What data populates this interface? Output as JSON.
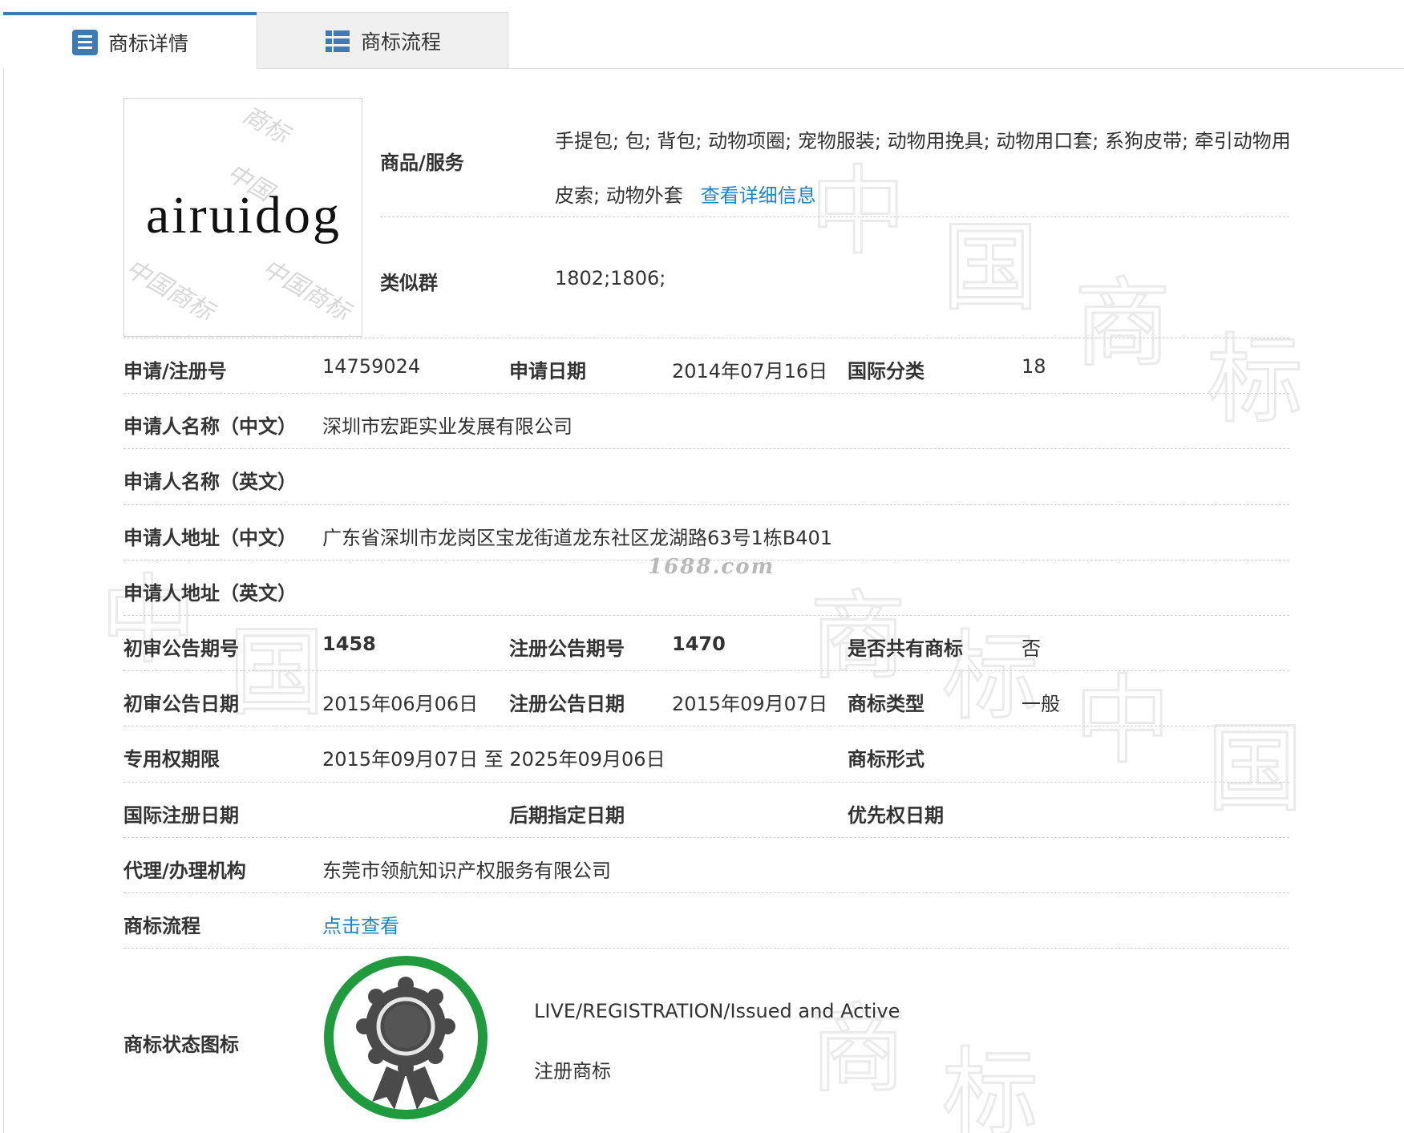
{
  "tabs": [
    {
      "label": "商标详情",
      "icon": "document-list-icon",
      "active": true
    },
    {
      "label": "商标流程",
      "icon": "flow-list-icon",
      "active": false
    }
  ],
  "trademark": {
    "logo_text": "airuidog",
    "logo_watermark": [
      "商标",
      "中国",
      "中国商标",
      "中国商标"
    ],
    "goods_label": "商品/服务",
    "goods_text": "手提包; 包; 背包; 动物项圈; 宠物服装; 动物用挽具; 动物用口套; 系狗皮带; 牵引动物用皮索; 动物外套",
    "goods_link": "查看详细信息",
    "similar_group_label": "类似群",
    "similar_group": "1802;1806;"
  },
  "rows": {
    "reg_no_label": "申请/注册号",
    "reg_no": "14759024",
    "apply_date_label": "申请日期",
    "apply_date": "2014年07月16日",
    "intl_class_label": "国际分类",
    "intl_class": "18",
    "applicant_cn_label": "申请人名称（中文）",
    "applicant_cn": "深圳市宏距实业发展有限公司",
    "applicant_en_label": "申请人名称（英文）",
    "applicant_en": "",
    "address_cn_label": "申请人地址（中文）",
    "address_cn": "广东省深圳市龙岗区宝龙街道龙东社区龙湖路63号1栋B401",
    "address_en_label": "申请人地址（英文）",
    "address_en": "",
    "prelim_issue_label": "初审公告期号",
    "prelim_issue": "1458",
    "reg_issue_label": "注册公告期号",
    "reg_issue": "1470",
    "shared_label": "是否共有商标",
    "shared": "否",
    "prelim_date_label": "初审公告日期",
    "prelim_date": "2015年06月06日",
    "reg_date_label": "注册公告日期",
    "reg_date": "2015年09月07日",
    "tm_type_label": "商标类型",
    "tm_type": "一般",
    "term_label": "专用权期限",
    "term": "2015年09月07日 至 2025年09月06日",
    "tm_form_label": "商标形式",
    "tm_form": "",
    "intl_reg_date_label": "国际注册日期",
    "intl_reg_date": "",
    "later_date_label": "后期指定日期",
    "later_date": "",
    "priority_date_label": "优先权日期",
    "priority_date": "",
    "agent_label": "代理/办理机构",
    "agent": "东莞市领航知识产权服务有限公司",
    "process_label": "商标流程",
    "process_link": "点击查看",
    "status_label": "商标状态图标",
    "status_en": "LIVE/REGISTRATION/Issued and Active",
    "status_cn": "注册商标"
  },
  "watermark": {
    "site": "1688.com",
    "chars": [
      "中",
      "国",
      "商",
      "标",
      "中",
      "国",
      "商",
      "标",
      "中",
      "国",
      "商",
      "标"
    ]
  },
  "colors": {
    "tab_accent": "#3e7ab8",
    "link": "#1f87c9",
    "badge_ring": "#1f9a3c",
    "badge_seal": "#4a4a4a"
  }
}
